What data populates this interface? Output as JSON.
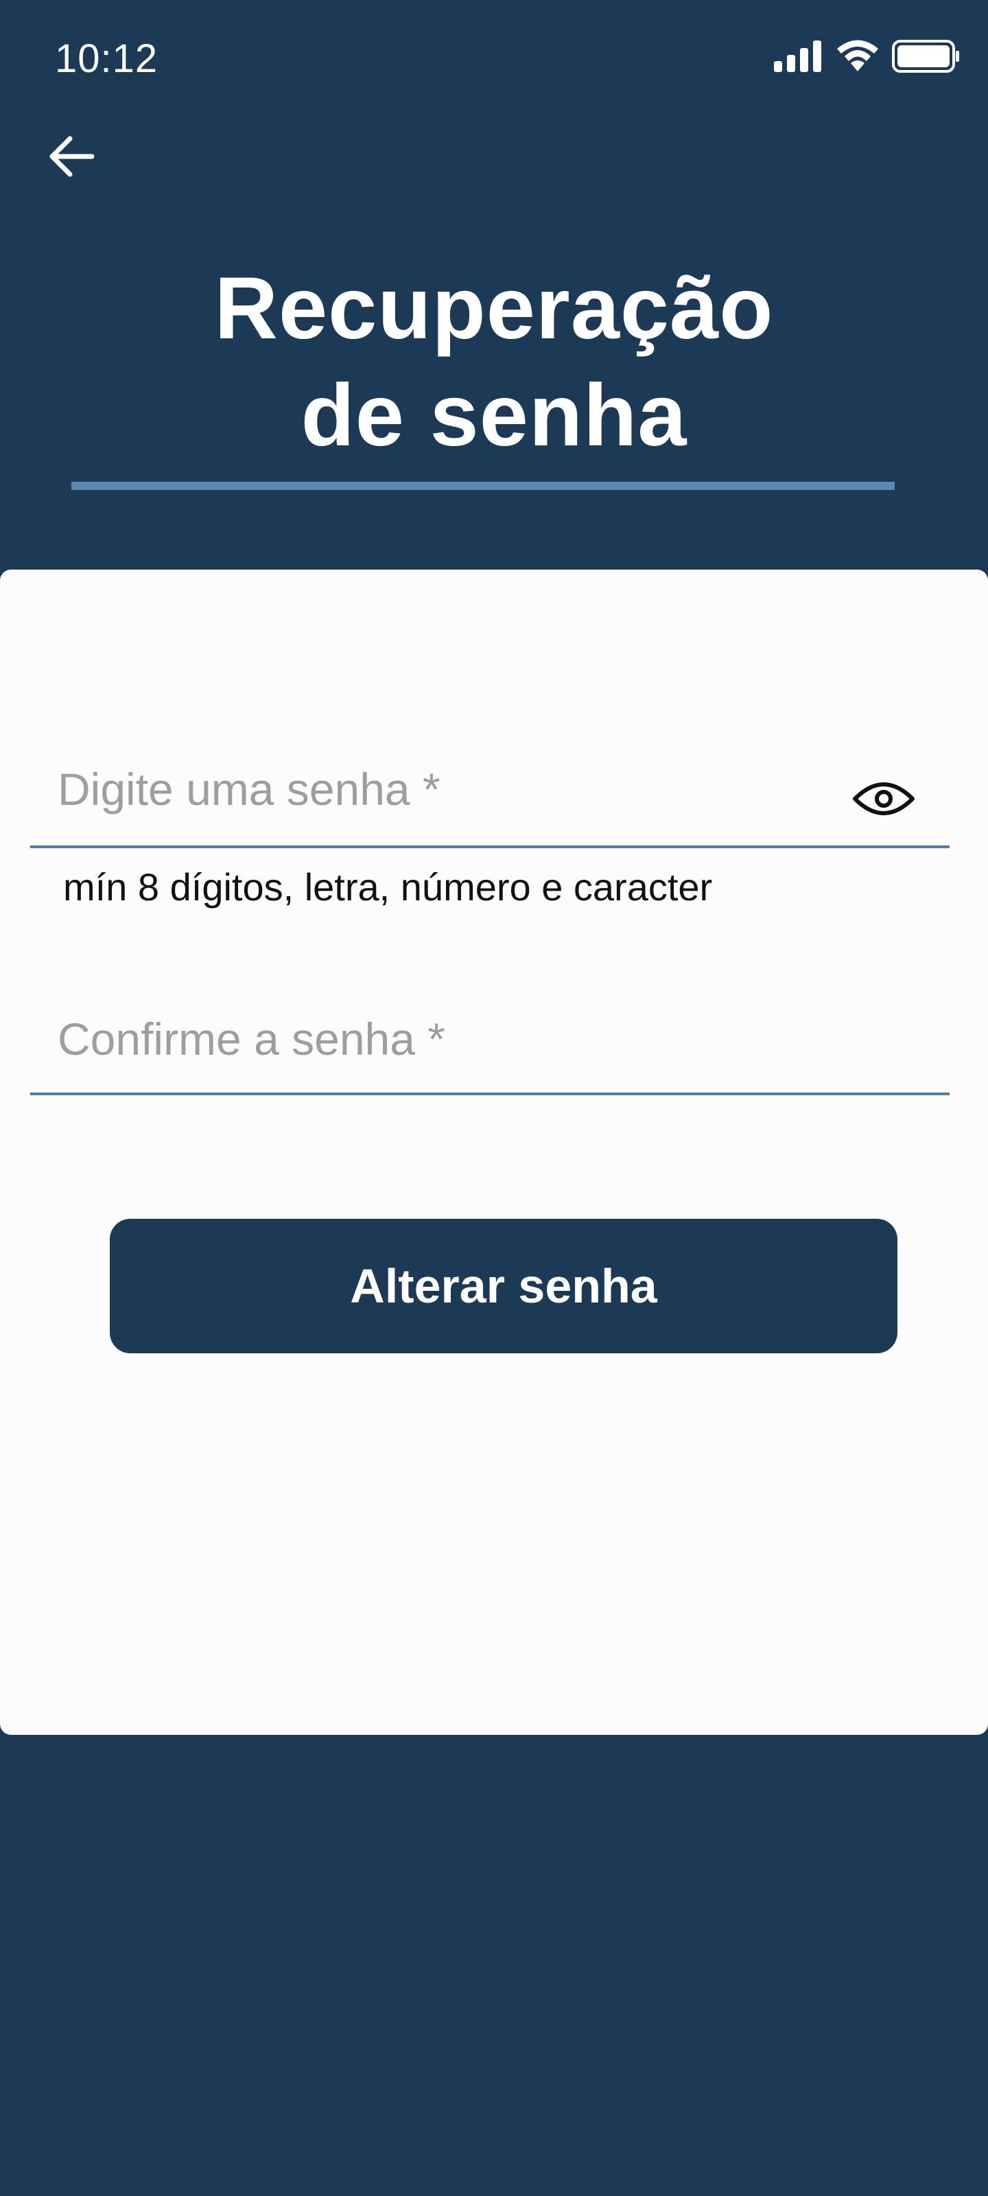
{
  "status_bar": {
    "time": "10:12",
    "icons": [
      "signal-icon",
      "wifi-icon",
      "battery-icon"
    ]
  },
  "header": {
    "back_icon": "arrow-left-icon",
    "title_line1": "Recuperação",
    "title_line2": "de senha"
  },
  "form": {
    "password": {
      "placeholder": "Digite uma senha *",
      "value": "",
      "toggle_icon": "eye-icon",
      "helper": "mín 8 dígitos, letra, número e caracter"
    },
    "confirm": {
      "placeholder": "Confirme a senha *",
      "value": ""
    },
    "submit_label": "Alterar senha"
  },
  "colors": {
    "background": "#1c3a56",
    "card": "#fcfcfc",
    "accent_line": "#5b87b2",
    "input_line": "#4f7aa3",
    "placeholder": "#9e9e9e"
  }
}
